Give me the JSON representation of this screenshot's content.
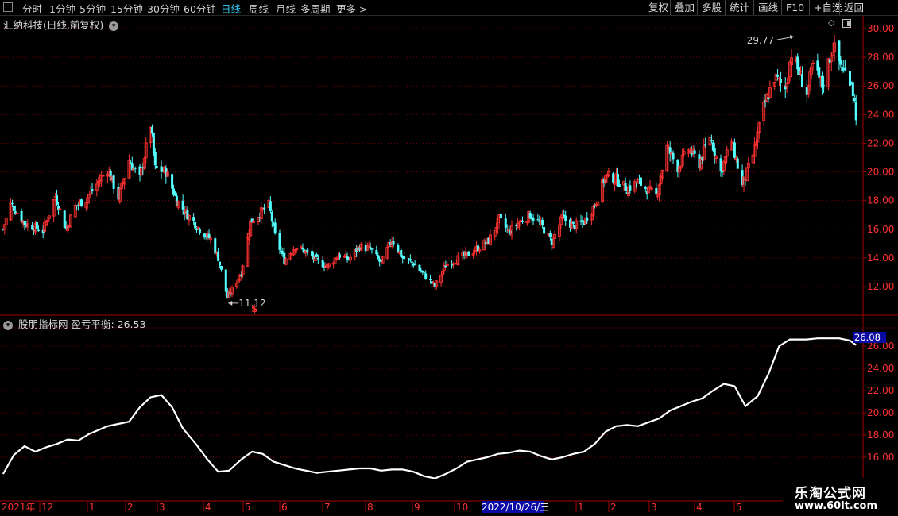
{
  "toolbar": {
    "periods": [
      "分时",
      "1分钟",
      "5分钟",
      "15分钟",
      "30分钟",
      "60分钟",
      "日线",
      "周线",
      "月线",
      "多周期",
      "更多 >"
    ],
    "active_period": "日线",
    "right_buttons": [
      "复权",
      "叠加",
      "多股",
      "统计",
      "画线",
      "F10",
      "+自选",
      "返回"
    ]
  },
  "main": {
    "title": "汇纳科技(日线,前复权)",
    "high_label": "29.77",
    "low_label": "11.12",
    "marker": "$"
  },
  "indicator": {
    "title": "股朋指标网  盈亏平衡: 26.53",
    "current_value": "26.08"
  },
  "time_axis": {
    "labels": [
      "2021年",
      "12",
      "1",
      "2",
      "3",
      "4",
      "5",
      "6",
      "7",
      "8",
      "9",
      "10",
      "2022/10/26/三",
      "1",
      "2",
      "3",
      "4",
      "5"
    ]
  },
  "watermark": {
    "line1": "乐淘公式网",
    "line2": "www.60lt.com"
  },
  "colors": {
    "up": "#ff3232",
    "down": "#54ffff",
    "indicator_line": "#ffffff",
    "grid": "#7a0000",
    "frame": "#a00000",
    "highlight_bg": "#0a0aa5"
  },
  "chart_data": [
    {
      "type": "candlestick",
      "title": "汇纳科技(日线,前复权)",
      "ylim": [
        11,
        30
      ],
      "yticks": [
        12,
        14,
        16,
        18,
        20,
        22,
        24,
        26,
        28,
        30
      ],
      "annotations": [
        {
          "text": "29.77",
          "value": 29.77
        },
        {
          "text": "11.12",
          "value": 11.12
        }
      ],
      "close_path": [
        [
          "2021-12-01",
          16.0
        ],
        [
          "2021-12-06",
          17.8
        ],
        [
          "2021-12-15",
          16.4
        ],
        [
          "2021-12-27",
          15.9
        ],
        [
          "2022-01-04",
          18.3
        ],
        [
          "2022-01-11",
          16.0
        ],
        [
          "2022-01-17",
          17.6
        ],
        [
          "2022-01-24",
          18.1
        ],
        [
          "2022-02-07",
          20.2
        ],
        [
          "2022-02-14",
          18.2
        ],
        [
          "2022-02-21",
          20.8
        ],
        [
          "2022-02-28",
          19.5
        ],
        [
          "2022-03-07",
          23.3
        ],
        [
          "2022-03-10",
          20.2
        ],
        [
          "2022-03-17",
          20.0
        ],
        [
          "2022-03-24",
          18.0
        ],
        [
          "2022-03-31",
          17.0
        ],
        [
          "2022-04-08",
          16.0
        ],
        [
          "2022-04-15",
          15.3
        ],
        [
          "2022-04-20",
          14.0
        ],
        [
          "2022-04-26",
          11.2
        ],
        [
          "2022-05-05",
          13.0
        ],
        [
          "2022-05-11",
          16.5
        ],
        [
          "2022-05-18",
          17.2
        ],
        [
          "2022-05-23",
          17.7
        ],
        [
          "2022-05-27",
          15.5
        ],
        [
          "2022-06-02",
          13.8
        ],
        [
          "2022-06-09",
          14.8
        ],
        [
          "2022-06-16",
          14.4
        ],
        [
          "2022-06-23",
          13.8
        ],
        [
          "2022-06-30",
          13.4
        ],
        [
          "2022-07-07",
          14.2
        ],
        [
          "2022-07-14",
          13.9
        ],
        [
          "2022-07-21",
          14.8
        ],
        [
          "2022-07-28",
          14.6
        ],
        [
          "2022-08-04",
          13.6
        ],
        [
          "2022-08-11",
          15.3
        ],
        [
          "2022-08-18",
          14.0
        ],
        [
          "2022-08-25",
          13.6
        ],
        [
          "2022-09-01",
          12.8
        ],
        [
          "2022-09-08",
          12.0
        ],
        [
          "2022-09-15",
          13.5
        ],
        [
          "2022-09-22",
          13.9
        ],
        [
          "2022-09-29",
          14.2
        ],
        [
          "2022-10-13",
          15.2
        ],
        [
          "2022-10-20",
          16.7
        ],
        [
          "2022-10-26",
          15.8
        ],
        [
          "2022-11-02",
          16.5
        ],
        [
          "2022-11-09",
          17.0
        ],
        [
          "2022-11-16",
          16.3
        ],
        [
          "2022-11-23",
          15.1
        ],
        [
          "2022-11-30",
          16.8
        ],
        [
          "2022-12-07",
          16.2
        ],
        [
          "2022-12-14",
          16.5
        ],
        [
          "2022-12-21",
          17.7
        ],
        [
          "2022-12-28",
          19.7
        ],
        [
          "2023-01-04",
          19.5
        ],
        [
          "2023-01-11",
          18.8
        ],
        [
          "2023-01-18",
          19.3
        ],
        [
          "2023-01-30",
          18.3
        ],
        [
          "2023-02-06",
          21.7
        ],
        [
          "2023-02-13",
          20.3
        ],
        [
          "2023-02-20",
          21.6
        ],
        [
          "2023-02-27",
          20.6
        ],
        [
          "2023-03-06",
          22.5
        ],
        [
          "2023-03-13",
          20.0
        ],
        [
          "2023-03-20",
          22.2
        ],
        [
          "2023-03-27",
          19.0
        ],
        [
          "2023-04-03",
          21.2
        ],
        [
          "2023-04-10",
          24.5
        ],
        [
          "2023-04-17",
          26.6
        ],
        [
          "2023-04-24",
          25.8
        ],
        [
          "2023-04-28",
          28.3
        ],
        [
          "2023-05-08",
          25.5
        ],
        [
          "2023-05-12",
          27.4
        ],
        [
          "2023-05-18",
          26.0
        ],
        [
          "2023-05-25",
          28.8
        ],
        [
          "2023-05-31",
          27.2
        ],
        [
          "2023-06-06",
          26.4
        ],
        [
          "2023-06-09",
          24.0
        ]
      ]
    },
    {
      "type": "line",
      "title": "股朋指标网",
      "series": [
        {
          "name": "盈亏平衡"
        }
      ],
      "ylim": [
        14.5,
        28
      ],
      "yticks": [
        16,
        18,
        20,
        22,
        24,
        26
      ],
      "x": [
        "2021-12-01",
        "2021-12-08",
        "2021-12-15",
        "2021-12-22",
        "2021-12-29",
        "2022-01-05",
        "2022-01-12",
        "2022-01-19",
        "2022-01-26",
        "2022-02-07",
        "2022-02-14",
        "2022-02-21",
        "2022-02-28",
        "2022-03-07",
        "2022-03-14",
        "2022-03-21",
        "2022-03-28",
        "2022-04-06",
        "2022-04-13",
        "2022-04-20",
        "2022-04-27",
        "2022-05-05",
        "2022-05-12",
        "2022-05-19",
        "2022-05-26",
        "2022-06-02",
        "2022-06-09",
        "2022-06-16",
        "2022-06-23",
        "2022-06-30",
        "2022-07-07",
        "2022-07-14",
        "2022-07-21",
        "2022-07-28",
        "2022-08-04",
        "2022-08-11",
        "2022-08-18",
        "2022-08-25",
        "2022-09-01",
        "2022-09-08",
        "2022-09-15",
        "2022-09-22",
        "2022-09-29",
        "2022-10-12",
        "2022-10-19",
        "2022-10-26",
        "2022-11-02",
        "2022-11-09",
        "2022-11-16",
        "2022-11-23",
        "2022-11-30",
        "2022-12-07",
        "2022-12-14",
        "2022-12-21",
        "2022-12-28",
        "2023-01-04",
        "2023-01-11",
        "2023-01-18",
        "2023-02-01",
        "2023-02-08",
        "2023-02-15",
        "2023-02-22",
        "2023-03-01",
        "2023-03-08",
        "2023-03-15",
        "2023-03-22",
        "2023-03-29",
        "2023-04-06",
        "2023-04-13",
        "2023-04-20",
        "2023-04-27",
        "2023-05-08",
        "2023-05-15",
        "2023-05-22",
        "2023-05-29",
        "2023-06-05",
        "2023-06-09"
      ],
      "values": [
        14.5,
        16.2,
        17.0,
        16.5,
        16.9,
        17.2,
        17.6,
        17.5,
        18.1,
        18.8,
        19.0,
        19.2,
        20.5,
        21.4,
        21.6,
        20.5,
        18.6,
        17.1,
        15.8,
        14.7,
        14.8,
        15.8,
        16.5,
        16.3,
        15.6,
        15.3,
        15.0,
        14.8,
        14.6,
        14.7,
        14.8,
        14.9,
        15.0,
        15.0,
        14.8,
        14.9,
        14.9,
        14.7,
        14.3,
        14.1,
        14.5,
        15.0,
        15.6,
        16.0,
        16.3,
        16.4,
        16.6,
        16.5,
        16.1,
        15.8,
        16.0,
        16.3,
        16.5,
        17.2,
        18.3,
        18.8,
        18.9,
        18.8,
        19.5,
        20.2,
        20.6,
        21.0,
        21.3,
        22.0,
        22.6,
        22.4,
        20.6,
        21.5,
        23.5,
        26.0,
        26.6,
        26.6,
        26.7,
        26.7,
        26.7,
        26.5,
        26.1
      ]
    }
  ]
}
